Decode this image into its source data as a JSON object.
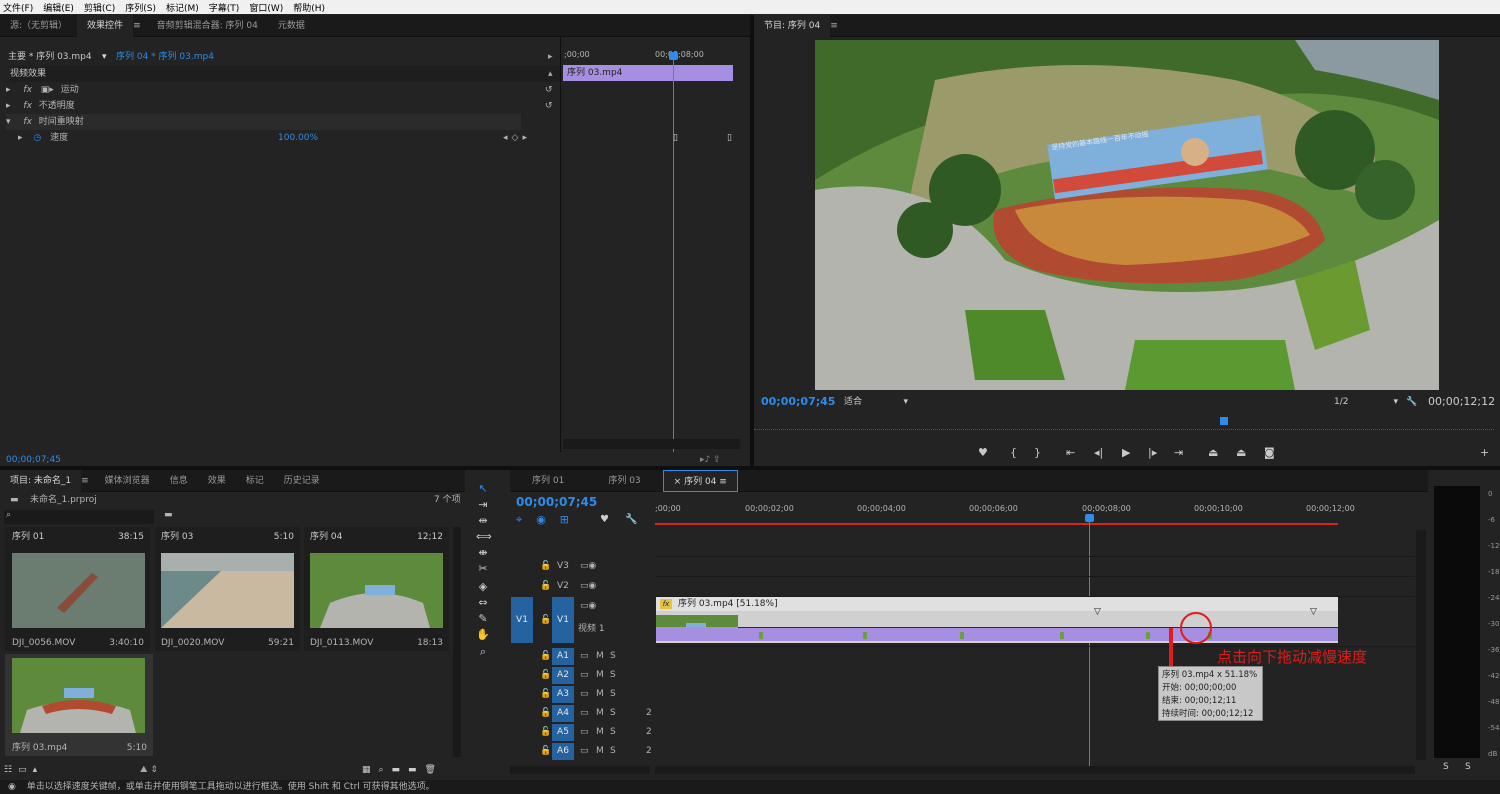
{
  "menu": [
    "文件(F)",
    "编辑(E)",
    "剪辑(C)",
    "序列(S)",
    "标记(M)",
    "字幕(T)",
    "窗口(W)",
    "帮助(H)"
  ],
  "source_tabs": {
    "source": "源:（无剪辑）",
    "effect_controls": "效果控件",
    "audio_mixer": "音频剪辑混合器: 序列 04",
    "metadata": "元数据"
  },
  "effect_controls": {
    "master": "主要 * 序列 03.mp4",
    "sequence_clip": "序列 04 * 序列 03.mp4",
    "ruler_start": ";00;00",
    "ruler_mid": "00;00;08;00",
    "clip_label": "序列 03.mp4",
    "video_effects": "视频效果",
    "motion": "运动",
    "opacity": "不透明度",
    "time_remap": "时间重映射",
    "speed_label": "速度",
    "speed_value": "100.00%",
    "timecode": "00;00;07;45"
  },
  "program": {
    "title": "节目: 序列 04",
    "timecode": "00;00;07;45",
    "fit": "适合",
    "resolution": "1/2",
    "duration": "00;00;12;12",
    "billboard_text": "坚持党的基本路线一百年不动摇"
  },
  "project": {
    "tabs": [
      "项目: 未命名_1",
      "媒体浏览器",
      "信息",
      "效果",
      "标记",
      "历史记录"
    ],
    "file": "未命名_1.prproj",
    "count": "7 个项",
    "items": [
      {
        "name": "序列 01",
        "duration": "38:15",
        "caption": "DJI_0056.MOV",
        "caption_dur": "3:40:10"
      },
      {
        "name": "序列 03",
        "duration": "5:10",
        "caption": "DJI_0020.MOV",
        "caption_dur": "59:21"
      },
      {
        "name": "序列 04",
        "duration": "12;12",
        "caption": "DJI_0113.MOV",
        "caption_dur": "18:13"
      },
      {
        "name": "",
        "duration": "",
        "caption": "序列 03.mp4",
        "caption_dur": "5:10"
      }
    ]
  },
  "timeline": {
    "tabs": [
      "序列 01",
      "序列 03",
      "序列 04"
    ],
    "timecode": "00;00;07;45",
    "ruler": [
      ";00;00",
      "00;00;02;00",
      "00;00;04;00",
      "00;00;06;00",
      "00;00;08;00",
      "00;00;10;00",
      "00;00;12;00"
    ],
    "tracks": {
      "v3": "V3",
      "v2": "V2",
      "v1": "V1",
      "v1_name": "视频 1",
      "a1": "A1",
      "a2": "A2",
      "a3": "A3",
      "a4": "A4",
      "a5": "A5",
      "a6": "A6",
      "m": "M",
      "s": "S",
      "two": "2"
    },
    "clip_label": "序列 03.mp4 [51.18%]",
    "fx_badge": "fx",
    "tooltip": {
      "line1": "序列 03.mp4 x 51.18%",
      "line2": "开始: 00;00;00;00",
      "line3": "结束: 00;00;12;11",
      "line4": "持续时间: 00;00;12;12"
    },
    "annotation": "点击向下拖动减慢速度"
  },
  "meter": {
    "labels": [
      "0",
      "-6",
      "-12",
      "-18",
      "-24",
      "-30",
      "-36",
      "-42",
      "-48",
      "-54",
      "dB"
    ],
    "bottom": [
      "S",
      "S"
    ]
  },
  "status": "单击以选择速度关键帧，或单击并使用钢笔工具拖动以进行框选。使用 Shift 和 Ctrl 可获得其他选项。",
  "colors": {
    "accent": "#2d8ceb",
    "clip": "#a68fe0",
    "playhead": "#2d8ceb",
    "annotation": "#e01c1c"
  }
}
